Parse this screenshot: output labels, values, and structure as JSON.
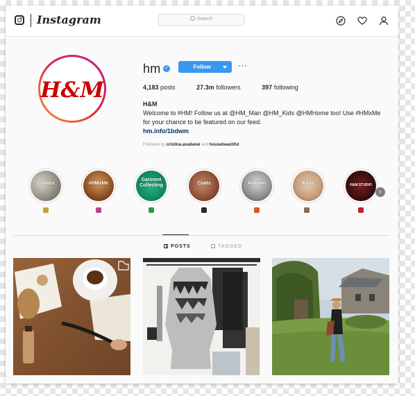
{
  "app": {
    "wordmark": "Instagram"
  },
  "search": {
    "placeholder": "Search"
  },
  "nav": {
    "icons": [
      "compass-icon",
      "heart-icon",
      "person-icon"
    ]
  },
  "profile": {
    "avatar_text": "H&M",
    "username": "hm",
    "follow_label": "Follow",
    "more_label": "···",
    "posts_count": "4,183",
    "posts_label": "posts",
    "followers_count": "27.3m",
    "followers_label": "followers",
    "following_count": "397",
    "following_label": "following",
    "name": "H&M",
    "bio_line1": "Welcome to #HM! Follow us at @HM_Man @HM_Kids @HMHome too! Use #HMxMe",
    "bio_line2": "for your chance to be featured on our feed.",
    "link": "hm.info/1bdwm",
    "followed_by_prefix": "Followed by",
    "followed_by_user1": "cristina.avadanei",
    "followed_by_and": "and",
    "followed_by_user2": "housebeautiful"
  },
  "highlights": [
    {
      "label": "Collabs",
      "emoji_color": "#c8a03a"
    },
    {
      "label": "#HMxMe",
      "emoji_color": "#b3488e"
    },
    {
      "label": "Garment Collecting",
      "emoji_color": "#2e9a3e"
    },
    {
      "label": "Coats",
      "emoji_color": "#2a2a2a"
    },
    {
      "label": "Autumn",
      "emoji_color": "#d8542a"
    },
    {
      "label": "Knits",
      "emoji_color": "#8a6b4a"
    },
    {
      "label": "H&M STUDIO",
      "emoji_color": "#c0202a"
    }
  ],
  "tabs": [
    {
      "label": "POSTS"
    },
    {
      "label": "TAGGED"
    }
  ],
  "colors": {
    "accent": "#3897f0",
    "brand_red": "#cc0000",
    "link": "#003569"
  }
}
